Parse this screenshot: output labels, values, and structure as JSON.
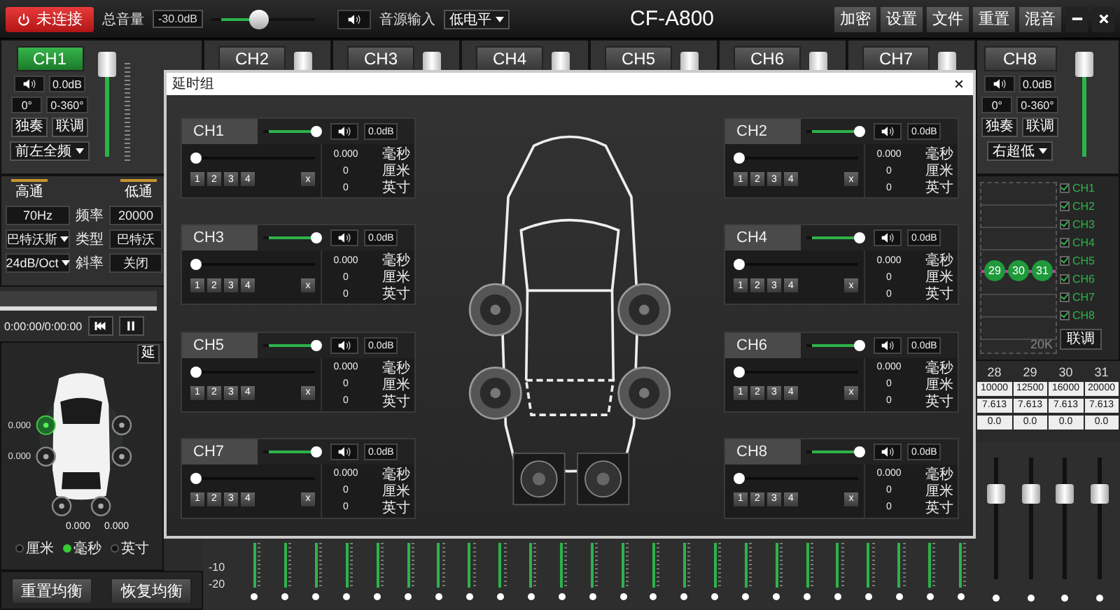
{
  "top_bar": {
    "connect_button": "未连接",
    "volume_label": "总音量",
    "volume_value": "-30.0dB",
    "volume_slider": {
      "level": 0.45
    },
    "source_label": "音源输入",
    "source_value": "低电平",
    "title": "CF-A800",
    "buttons": [
      "加密",
      "设置",
      "文件",
      "重置",
      "混音"
    ]
  },
  "channels": [
    {
      "label": "CH1",
      "selected": true,
      "level": 0.95,
      "gain": "0.0dB",
      "phase": "0°",
      "phase_range": "0-360°",
      "solo": "独奏",
      "link": "联调",
      "output": "前左全频"
    },
    {
      "label": "CH2",
      "selected": false,
      "level": 0.95
    },
    {
      "label": "CH3",
      "selected": false,
      "level": 0.95
    },
    {
      "label": "CH4",
      "selected": false,
      "level": 0.95
    },
    {
      "label": "CH5",
      "selected": false,
      "level": 0.95
    },
    {
      "label": "CH6",
      "selected": false,
      "level": 0.95
    },
    {
      "label": "CH7",
      "selected": false,
      "level": 0.95
    },
    {
      "label": "CH8",
      "selected": false,
      "level": 0.95,
      "gain": "0.0dB",
      "phase": "0°",
      "phase_range": "0-360°",
      "solo": "独奏",
      "link": "联调",
      "output": "右超低"
    }
  ],
  "filters": {
    "tabs": [
      "高通",
      "低通"
    ],
    "labels": [
      "频率",
      "类型",
      "斜率"
    ],
    "high_pass": [
      "70Hz",
      "巴特沃斯",
      "24dB/Oct"
    ],
    "low_pass": [
      "20000",
      "巴特沃",
      "关闭"
    ]
  },
  "player": {
    "time": "0:00:00/0:00:00",
    "progress": {
      "level": 0.0
    }
  },
  "speaker_map": {
    "button": "延",
    "values": [
      "0.000",
      "0.000",
      "0.000",
      "0.000"
    ],
    "units": [
      {
        "label": "厘米",
        "selected": false
      },
      {
        "label": "毫秒",
        "selected": true
      },
      {
        "label": "英寸",
        "selected": false
      }
    ]
  },
  "eq_buttons": [
    "重置均衡",
    "恢复均衡"
  ],
  "eq_graph": {
    "points": [
      "29",
      "30",
      "31"
    ],
    "axis_label": "20K"
  },
  "channel_checks": [
    {
      "label": "CH1",
      "checked": true
    },
    {
      "label": "CH2",
      "checked": true
    },
    {
      "label": "CH3",
      "checked": true
    },
    {
      "label": "CH4",
      "checked": true
    },
    {
      "label": "CH5",
      "checked": true
    },
    {
      "label": "CH6",
      "checked": true
    },
    {
      "label": "CH7",
      "checked": true
    },
    {
      "label": "CH8",
      "checked": true
    }
  ],
  "link_button": "联调",
  "eq_bands": [
    {
      "band": "28",
      "frequency": "10000",
      "q": "7.613",
      "gain": "0.0",
      "level": 0.7
    },
    {
      "band": "29",
      "frequency": "12500",
      "q": "7.613",
      "gain": "0.0",
      "level": 0.7
    },
    {
      "band": "30",
      "frequency": "16000",
      "q": "7.613",
      "gain": "0.0",
      "level": 0.7
    },
    {
      "band": "31",
      "frequency": "20000",
      "q": "7.613",
      "gain": "0.0",
      "level": 0.7
    }
  ],
  "eq_scale": [
    "-10",
    "-20"
  ],
  "delay_dialog": {
    "title": "延时组",
    "channels": [
      {
        "label": "CH1",
        "volume": {
          "level": 1
        },
        "gain": "0.0dB",
        "delay": {
          "level": 0
        },
        "values": [
          "0.000",
          "0",
          "0"
        ],
        "units": [
          "毫秒",
          "厘米",
          "英寸"
        ],
        "group_buttons": [
          "1",
          "2",
          "3",
          "4"
        ],
        "clear": "x"
      },
      {
        "label": "CH2",
        "volume": {
          "level": 1
        },
        "gain": "0.0dB",
        "delay": {
          "level": 0
        },
        "values": [
          "0.000",
          "0",
          "0"
        ],
        "units": [
          "毫秒",
          "厘米",
          "英寸"
        ],
        "group_buttons": [
          "1",
          "2",
          "3",
          "4"
        ],
        "clear": "x"
      },
      {
        "label": "CH3",
        "volume": {
          "level": 1
        },
        "gain": "0.0dB",
        "delay": {
          "level": 0
        },
        "values": [
          "0.000",
          "0",
          "0"
        ],
        "units": [
          "毫秒",
          "厘米",
          "英寸"
        ],
        "group_buttons": [
          "1",
          "2",
          "3",
          "4"
        ],
        "clear": "x"
      },
      {
        "label": "CH4",
        "volume": {
          "level": 1
        },
        "gain": "0.0dB",
        "delay": {
          "level": 0
        },
        "values": [
          "0.000",
          "0",
          "0"
        ],
        "units": [
          "毫秒",
          "厘米",
          "英寸"
        ],
        "group_buttons": [
          "1",
          "2",
          "3",
          "4"
        ],
        "clear": "x"
      },
      {
        "label": "CH5",
        "volume": {
          "level": 1
        },
        "gain": "0.0dB",
        "delay": {
          "level": 0
        },
        "values": [
          "0.000",
          "0",
          "0"
        ],
        "units": [
          "毫秒",
          "厘米",
          "英寸"
        ],
        "group_buttons": [
          "1",
          "2",
          "3",
          "4"
        ],
        "clear": "x"
      },
      {
        "label": "CH6",
        "volume": {
          "level": 1
        },
        "gain": "0.0dB",
        "delay": {
          "level": 0
        },
        "values": [
          "0.000",
          "0",
          "0"
        ],
        "units": [
          "毫秒",
          "厘米",
          "英寸"
        ],
        "group_buttons": [
          "1",
          "2",
          "3",
          "4"
        ],
        "clear": "x"
      },
      {
        "label": "CH7",
        "volume": {
          "level": 1
        },
        "gain": "0.0dB",
        "delay": {
          "level": 0
        },
        "values": [
          "0.000",
          "0",
          "0"
        ],
        "units": [
          "毫秒",
          "厘米",
          "英寸"
        ],
        "group_buttons": [
          "1",
          "2",
          "3",
          "4"
        ],
        "clear": "x"
      },
      {
        "label": "CH8",
        "volume": {
          "level": 1
        },
        "gain": "0.0dB",
        "delay": {
          "level": 0
        },
        "values": [
          "0.000",
          "0",
          "0"
        ],
        "units": [
          "毫秒",
          "厘米",
          "英寸"
        ],
        "group_buttons": [
          "1",
          "2",
          "3",
          "4"
        ],
        "clear": "x"
      }
    ]
  }
}
